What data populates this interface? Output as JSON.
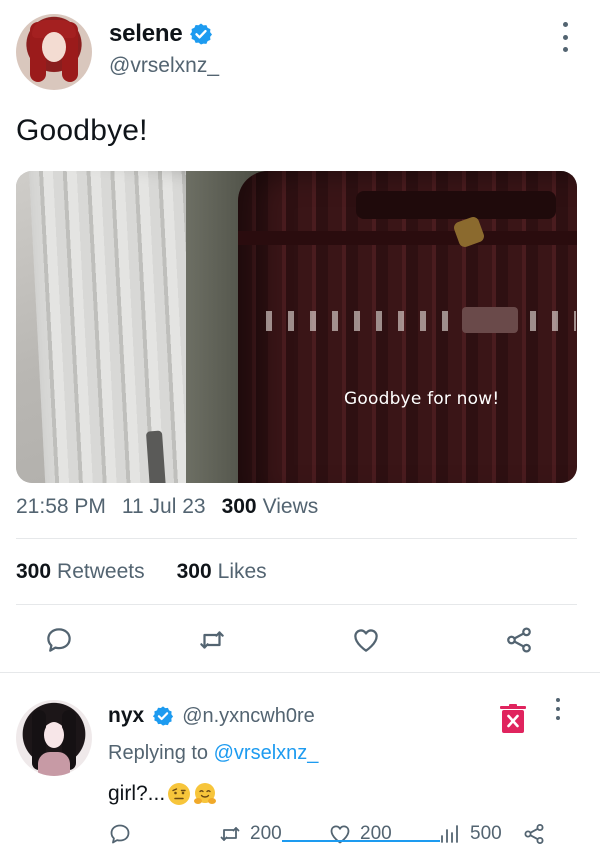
{
  "tweet": {
    "author": {
      "display_name": "selene",
      "handle": "@vrselxnz_",
      "verified": true
    },
    "text": "Goodbye!",
    "media": {
      "caption": "Goodbye for now!"
    },
    "time": "21:58 PM",
    "date": "11 Jul 23",
    "views_count": "300",
    "views_label": "Views",
    "retweets_count": "300",
    "retweets_label": "Retweets",
    "likes_count": "300",
    "likes_label": "Likes",
    "actions": [
      "reply-icon",
      "retweet-icon",
      "like-icon",
      "share-icon"
    ]
  },
  "reply": {
    "author": {
      "display_name": "nyx",
      "handle": "@n.yxncwh0re",
      "verified": true
    },
    "replying_prefix": "Replying to",
    "replying_to": "@vrselxnz_",
    "text": "girl?...",
    "emojis": [
      "raised-eyebrow-emoji",
      "hugging-emoji"
    ],
    "retweets": "200",
    "likes": "200",
    "views": "500"
  },
  "colors": {
    "accent": "#1d9bf0",
    "secondary_text": "#536471",
    "delete_red": "#e0245e"
  }
}
